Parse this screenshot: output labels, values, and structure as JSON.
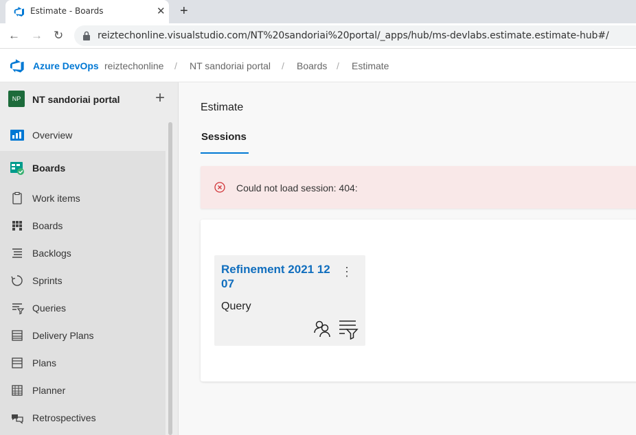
{
  "browser": {
    "tab_title": "Estimate - Boards",
    "tab_close": "✕",
    "new_tab": "+",
    "url": "reiztechonline.visualstudio.com/NT%20sandoriai%20portal/_apps/hub/ms-devlabs.estimate.estimate-hub#/",
    "back": "←",
    "forward": "→",
    "reload": "↻"
  },
  "header": {
    "brand": "Azure DevOps",
    "breadcrumbs": [
      "reiztechonline",
      "NT sandoriai portal",
      "Boards",
      "Estimate"
    ],
    "separator": "/"
  },
  "sidebar": {
    "project_initials": "NP",
    "project_name": "NT sandoriai portal",
    "add": "+",
    "items": [
      {
        "label": "Overview",
        "icon": "overview-icon"
      },
      {
        "label": "Boards",
        "icon": "boards-hub-icon"
      },
      {
        "label": "Work items",
        "icon": "work-items-icon"
      },
      {
        "label": "Boards",
        "icon": "boards-icon"
      },
      {
        "label": "Backlogs",
        "icon": "backlogs-icon"
      },
      {
        "label": "Sprints",
        "icon": "sprints-icon"
      },
      {
        "label": "Queries",
        "icon": "queries-icon"
      },
      {
        "label": "Delivery Plans",
        "icon": "delivery-plans-icon"
      },
      {
        "label": "Plans",
        "icon": "plans-icon"
      },
      {
        "label": "Planner",
        "icon": "planner-icon"
      },
      {
        "label": "Retrospectives",
        "icon": "retrospectives-icon"
      }
    ]
  },
  "main": {
    "title": "Estimate",
    "pivot": "Sessions",
    "error": "Could not load session: 404:",
    "session": {
      "title": "Refinement 2021 12 07",
      "type": "Query",
      "more": "⋮"
    }
  },
  "colors": {
    "accent": "#0078d4",
    "error_bg": "#f9e8e8",
    "error_icon": "#d13438"
  }
}
